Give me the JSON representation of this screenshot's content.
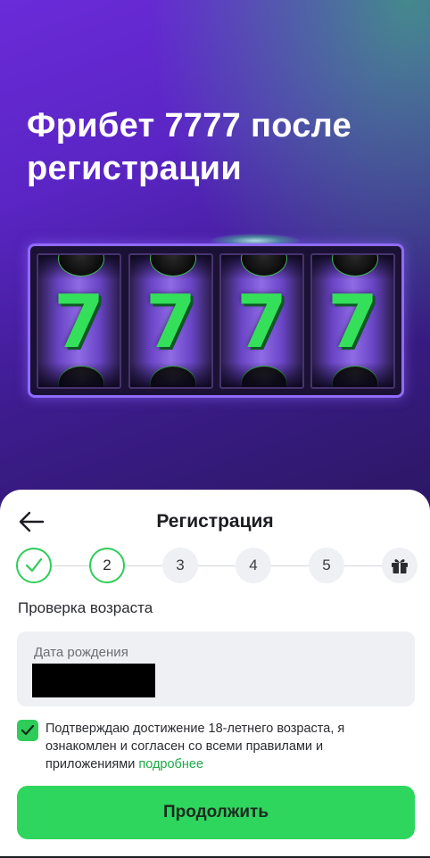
{
  "hero": {
    "title": "Фрибет 7777 после регистрации"
  },
  "slot": {
    "reels": [
      {
        "symbol": "7",
        "top": "hockey-puck-icon",
        "bottom": "hockey-puck-icon"
      },
      {
        "symbol": "7",
        "top": "hockey-puck-icon",
        "bottom": "soccer-ball-icon"
      },
      {
        "symbol": "7",
        "top": "soccer-ball-icon",
        "bottom": "basketball-icon"
      },
      {
        "symbol": "7",
        "top": "basketball-icon",
        "bottom": "hockey-puck-icon"
      }
    ],
    "accent_color": "#8f6bff",
    "symbol_color": "#34e05a"
  },
  "registration": {
    "title": "Регистрация",
    "back_icon": "arrow-left-icon",
    "steps": [
      {
        "label": "",
        "state": "done",
        "icon": "check-icon"
      },
      {
        "label": "2",
        "state": "active"
      },
      {
        "label": "3",
        "state": "pending"
      },
      {
        "label": "4",
        "state": "pending"
      },
      {
        "label": "5",
        "state": "pending"
      },
      {
        "label": "",
        "state": "pending",
        "icon": "gift-icon"
      }
    ],
    "section_title": "Проверка возраста",
    "birthdate": {
      "label": "Дата рождения",
      "value": ""
    },
    "consent": {
      "checked": true,
      "text": "Подтверждаю достижение 18-летнего возраста, я ознакомлен и согласен со всеми правилами и приложениями",
      "link_text": "подробнее"
    },
    "continue_label": "Продолжить"
  },
  "colors": {
    "brand_green": "#2ed65d",
    "link_green": "#1faa49",
    "hero_purple": "#6a2bd8"
  }
}
